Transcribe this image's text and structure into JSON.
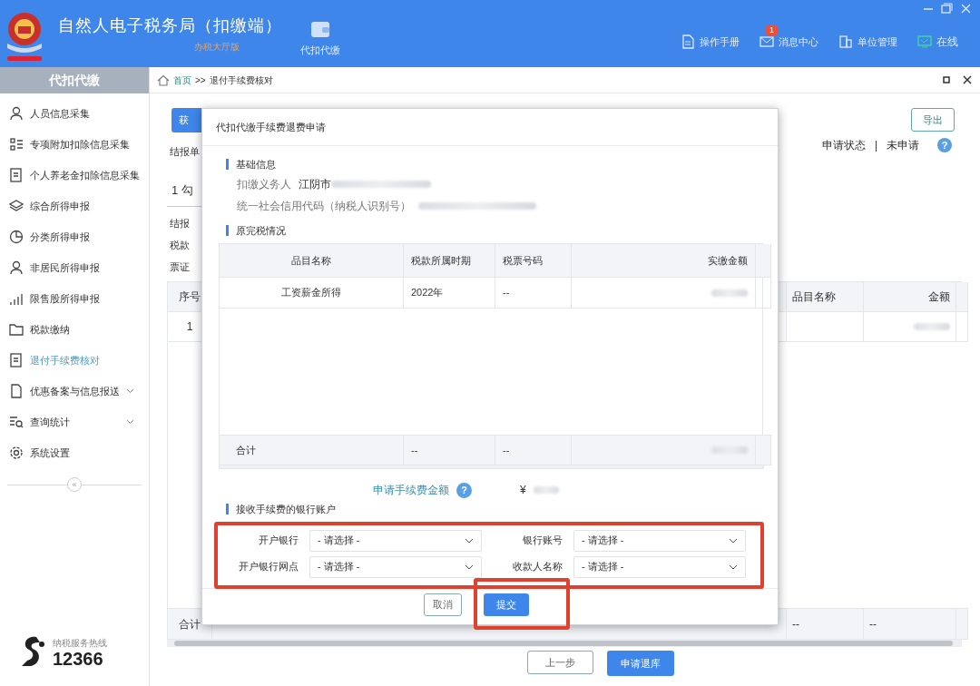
{
  "header": {
    "title": "自然人电子税务局（扣缴端）",
    "subtitle": "办税大厅版",
    "module": "代扣代缴",
    "nav": [
      {
        "kind": "manual",
        "label": "操作手册"
      },
      {
        "kind": "message",
        "label": "消息中心",
        "badge": "1"
      },
      {
        "kind": "org",
        "label": "单位管理"
      },
      {
        "kind": "online",
        "label": "在线"
      }
    ]
  },
  "sidebar": {
    "title": "代扣代缴",
    "items": [
      {
        "label": "人员信息采集",
        "selected": false
      },
      {
        "label": "专项附加扣除信息采集",
        "selected": false
      },
      {
        "label": "个人养老金扣除信息采集",
        "selected": false
      },
      {
        "label": "综合所得申报",
        "selected": false
      },
      {
        "label": "分类所得申报",
        "selected": false
      },
      {
        "label": "非居民所得申报",
        "selected": false
      },
      {
        "label": "限售股所得申报",
        "selected": false
      },
      {
        "label": "税款缴纳",
        "selected": false
      },
      {
        "label": "退付手续费核对",
        "selected": true
      },
      {
        "label": "优惠备案与信息报送",
        "selected": false,
        "expanded": false
      },
      {
        "label": "查询统计",
        "selected": false,
        "expanded": false
      },
      {
        "label": "系统设置",
        "selected": false
      }
    ],
    "collapse": "«"
  },
  "hotline": {
    "label": "纳税服务热线",
    "number": "12366"
  },
  "breadcrumb": {
    "home": "首页",
    "separator": ">>",
    "current": "退付手续费核对"
  },
  "main": {
    "fetch_button": "获",
    "export_button": "导出",
    "status_label": "申请状态",
    "status_separator": "|",
    "status_value": "未申请",
    "help": "?",
    "fields": [
      "结报单",
      "1 勾",
      "结报",
      "税款",
      "票证"
    ],
    "table": {
      "columns": [
        "序号",
        "品目名称",
        "金额"
      ],
      "rows": [
        {
          "cells": [
            "1",
            "",
            {
              "redacted": true
            }
          ]
        }
      ],
      "footer": [
        "合计",
        "--",
        "--"
      ]
    },
    "prev_button": "上一步",
    "refund_button": "申请退库"
  },
  "dialog": {
    "title": "代扣代缴手续费退费申请",
    "basic_heading": "基础信息",
    "withholder_label": "扣缴义务人",
    "withholder_value": "江阴市",
    "credit_label": "统一社会信用代码（纳税人识别号）",
    "tax_heading": "原完税情况",
    "tax_table": {
      "columns": [
        "品目名称",
        "税款所属时期",
        "税票号码",
        "实缴金额"
      ],
      "rows": [
        {
          "cells": [
            "工资薪金所得",
            "2022年",
            "--",
            {
              "redacted": true
            }
          ]
        }
      ],
      "footer": [
        "合计",
        "--",
        "--",
        {
          "redacted": true
        }
      ]
    },
    "fee_label": "申请手续费金额",
    "fee_help": "?",
    "fee_currency": "¥",
    "bank_heading": "接收手续费的银行账户",
    "bank_fields": [
      {
        "label": "开户银行",
        "placeholder": "- 请选择 -"
      },
      {
        "label": "银行账号",
        "placeholder": "- 请选择 -"
      },
      {
        "label": "开户银行网点",
        "placeholder": "- 请选择 -"
      },
      {
        "label": "收款人名称",
        "placeholder": "- 请选择 -"
      }
    ],
    "cancel_button": "取消",
    "submit_button": "提交",
    "highlighted": true
  }
}
